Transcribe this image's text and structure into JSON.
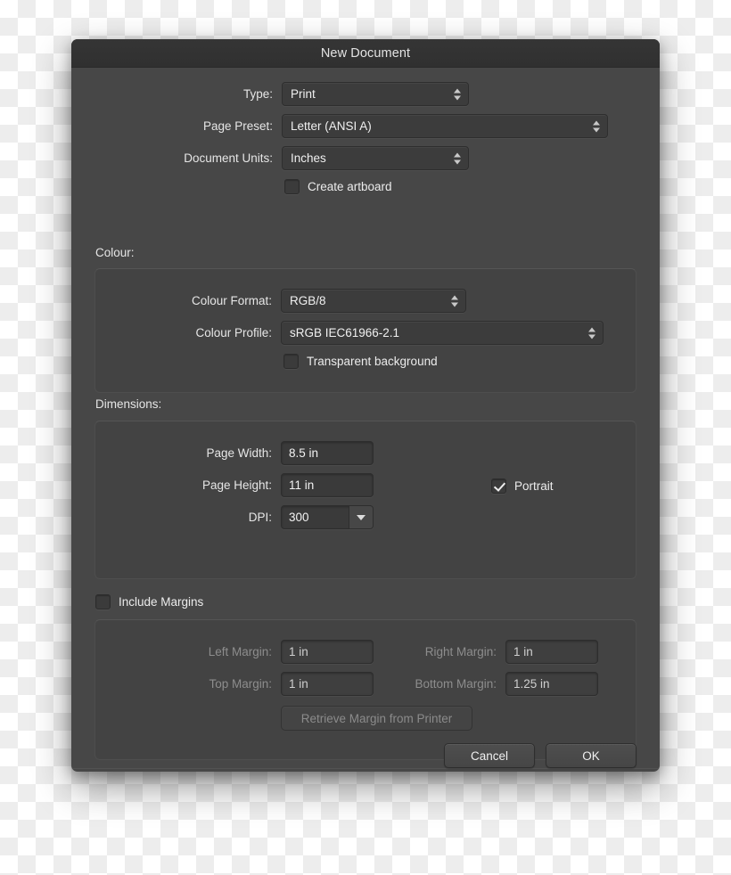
{
  "window": {
    "title": "New Document"
  },
  "top": {
    "type": {
      "label": "Type:",
      "value": "Print"
    },
    "page_preset": {
      "label": "Page Preset:",
      "value": "Letter (ANSI A)"
    },
    "document_units": {
      "label": "Document Units:",
      "value": "Inches"
    },
    "create_artboard": {
      "label": "Create artboard",
      "checked": false
    }
  },
  "colour": {
    "section_label": "Colour:",
    "colour_format": {
      "label": "Colour Format:",
      "value": "RGB/8"
    },
    "colour_profile": {
      "label": "Colour Profile:",
      "value": "sRGB IEC61966-2.1"
    },
    "transparent_background": {
      "label": "Transparent background",
      "checked": false
    }
  },
  "dimensions": {
    "section_label": "Dimensions:",
    "page_width": {
      "label": "Page Width:",
      "value": "8.5 in"
    },
    "page_height": {
      "label": "Page Height:",
      "value": "11 in"
    },
    "dpi": {
      "label": "DPI:",
      "value": "300"
    },
    "portrait": {
      "label": "Portrait",
      "checked": true
    }
  },
  "margins": {
    "include": {
      "label": "Include Margins",
      "checked": false
    },
    "left": {
      "label": "Left Margin:",
      "value": "1 in"
    },
    "right": {
      "label": "Right Margin:",
      "value": "1 in"
    },
    "top": {
      "label": "Top Margin:",
      "value": "1 in"
    },
    "bottom": {
      "label": "Bottom Margin:",
      "value": "1.25 in"
    },
    "retrieve_button": "Retrieve Margin from Printer"
  },
  "footer": {
    "cancel": "Cancel",
    "ok": "OK"
  },
  "colors": {
    "dialog_bg": "#474747",
    "titlebar_bg": "#333333",
    "group_bg": "#434343",
    "field_bg": "#3a3a3a",
    "text": "#ececec",
    "text_disabled": "#8d8d8d"
  }
}
